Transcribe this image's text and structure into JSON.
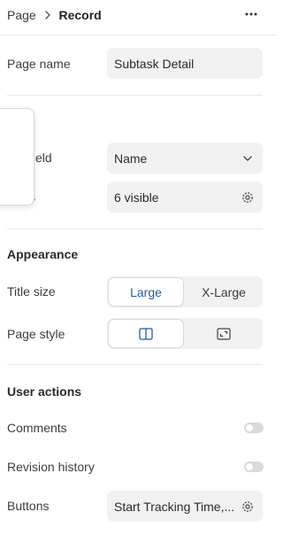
{
  "header": {
    "breadcrumb_parent": "Page",
    "breadcrumb_current": "Record",
    "more_icon": "more-horizontal-icon"
  },
  "settings": {
    "page_name": {
      "label": "Page name",
      "value": "Subtask Detail"
    },
    "title_field": {
      "label_visible": "field",
      "value": "Name"
    },
    "fields": {
      "label_visible": "s",
      "value": "6 visible"
    }
  },
  "appearance": {
    "title": "Appearance",
    "title_size": {
      "label": "Title size",
      "options": [
        "Large",
        "X-Large"
      ],
      "selected": "Large"
    },
    "page_style": {
      "label": "Page style",
      "options_icons": [
        "split-panel-icon",
        "fullscreen-icon"
      ],
      "selected": 0
    }
  },
  "user_actions": {
    "title": "User actions",
    "comments": {
      "label": "Comments",
      "enabled": false
    },
    "revision_history": {
      "label": "Revision history",
      "enabled": false
    },
    "buttons": {
      "label": "Buttons",
      "value": "Start Tracking Time,..."
    }
  },
  "colors": {
    "accent": "#1f5aa6",
    "field_bg": "#f1f1f1",
    "divider": "#e6e6e6",
    "toggle_off": "#dadada"
  }
}
